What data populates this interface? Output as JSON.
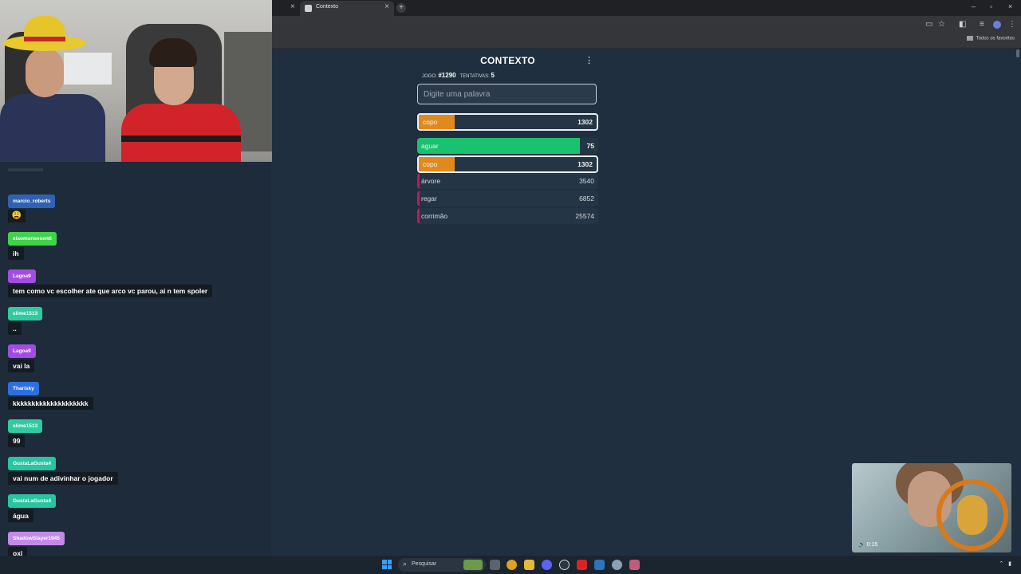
{
  "browser": {
    "tab_title": "Contexto",
    "tab_close": "×",
    "prev_tab_close": "×",
    "new_tab": "+",
    "window_minimize": "–",
    "window_restore": "▫",
    "window_close": "×",
    "bookmarks_folder": "Todos os favoritos",
    "toolbar_icons": [
      "cast-icon",
      "star-icon",
      "extensions-icon",
      "media-icon",
      "profile-icon",
      "more-icon"
    ]
  },
  "game": {
    "title": "CONTEXTO",
    "menu": "⋮",
    "game_label": "JOGO:",
    "game_number": "#1290",
    "attempts_label": "TENTATIVAS:",
    "attempts": "5",
    "input_placeholder": "Digite uma palavra",
    "latest_guess": {
      "word": "copo",
      "distance": "1302",
      "fill_fraction": 0.2,
      "color": "#e08a1e"
    },
    "guesses": [
      {
        "word": "aguar",
        "distance": "75",
        "fill_fraction": 0.9,
        "color": "#18c26f"
      },
      {
        "word": "copo",
        "distance": "1302",
        "fill_fraction": 0.2,
        "color": "#e08a1e"
      },
      {
        "word": "árvore",
        "distance": "3540",
        "fill_fraction": 0.01,
        "color": "#c2185b"
      },
      {
        "word": "regar",
        "distance": "6852",
        "fill_fraction": 0.01,
        "color": "#c2185b"
      },
      {
        "word": "corrimão",
        "distance": "25574",
        "fill_fraction": 0.01,
        "color": "#c2185b"
      }
    ]
  },
  "chat": {
    "messages": [
      {
        "user": "marcio_roberts",
        "text": "😩",
        "color": "#2f62b3",
        "emoji": true
      },
      {
        "user": "xiaomansesenti",
        "text": "ih",
        "color": "#3fd34a"
      },
      {
        "user": "Lagoa9",
        "text": "tem como vc escolher ate que arco vc parou, ai n tem spoler",
        "color": "#a34de0"
      },
      {
        "user": "slime1513",
        "text": "..",
        "color": "#2fcaa0"
      },
      {
        "user": "Lagoa9",
        "text": "vai la",
        "color": "#a34de0"
      },
      {
        "user": "Tharisky",
        "text": "kkkkkkkkkkkkkkkkkkkk",
        "color": "#2d6fe0"
      },
      {
        "user": "slime1513",
        "text": "99",
        "color": "#2fcaa0"
      },
      {
        "user": "GustaLaGusta4",
        "text": "vai num de adivinhar o jogador",
        "color": "#29c4a0"
      },
      {
        "user": "GustaLaGusta4",
        "text": "água",
        "color": "#29c4a0"
      },
      {
        "user": "ShadowSlayer1945",
        "text": "oxi",
        "color": "#c48ae8"
      }
    ]
  },
  "cam2": {
    "time": "0:15"
  },
  "taskbar": {
    "search_label": "Pesquisar"
  }
}
